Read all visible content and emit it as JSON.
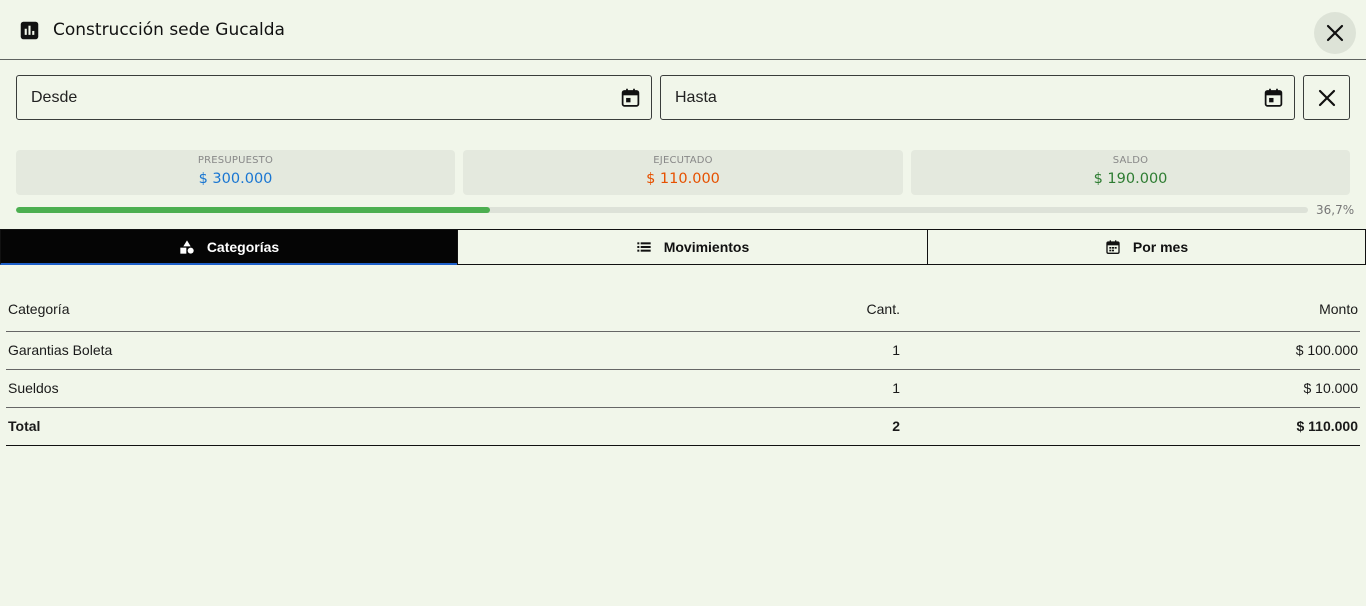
{
  "header": {
    "title": "Construcción sede Gucalda",
    "icon": "bar-chart-icon",
    "close_icon": "close-icon"
  },
  "filters": {
    "from_placeholder": "Desde",
    "to_placeholder": "Hasta",
    "calendar_icon": "calendar-icon",
    "clear_icon": "close-icon"
  },
  "summary": {
    "budget": {
      "label": "PRESUPUESTO",
      "value": "$ 300.000",
      "color": "#1976d2"
    },
    "executed": {
      "label": "EJECUTADO",
      "value": "$ 110.000",
      "color": "#e65100"
    },
    "balance": {
      "label": "SALDO",
      "value": "$ 190.000",
      "color": "#2e7d32"
    }
  },
  "progress": {
    "percent": 36.7,
    "label": "36,7%",
    "color": "#4caf50"
  },
  "tabs": [
    {
      "label": "Categorías",
      "icon": "category-shapes-icon",
      "active": true
    },
    {
      "label": "Movimientos",
      "icon": "list-icon",
      "active": false
    },
    {
      "label": "Por mes",
      "icon": "calendar-month-icon",
      "active": false
    }
  ],
  "table": {
    "headers": {
      "category": "Categoría",
      "count": "Cant.",
      "amount": "Monto"
    },
    "rows": [
      {
        "category": "Garantias Boleta",
        "count": "1",
        "amount": "$ 100.000"
      },
      {
        "category": "Sueldos",
        "count": "1",
        "amount": "$ 10.000"
      }
    ],
    "total": {
      "label": "Total",
      "count": "2",
      "amount": "$ 110.000"
    }
  }
}
